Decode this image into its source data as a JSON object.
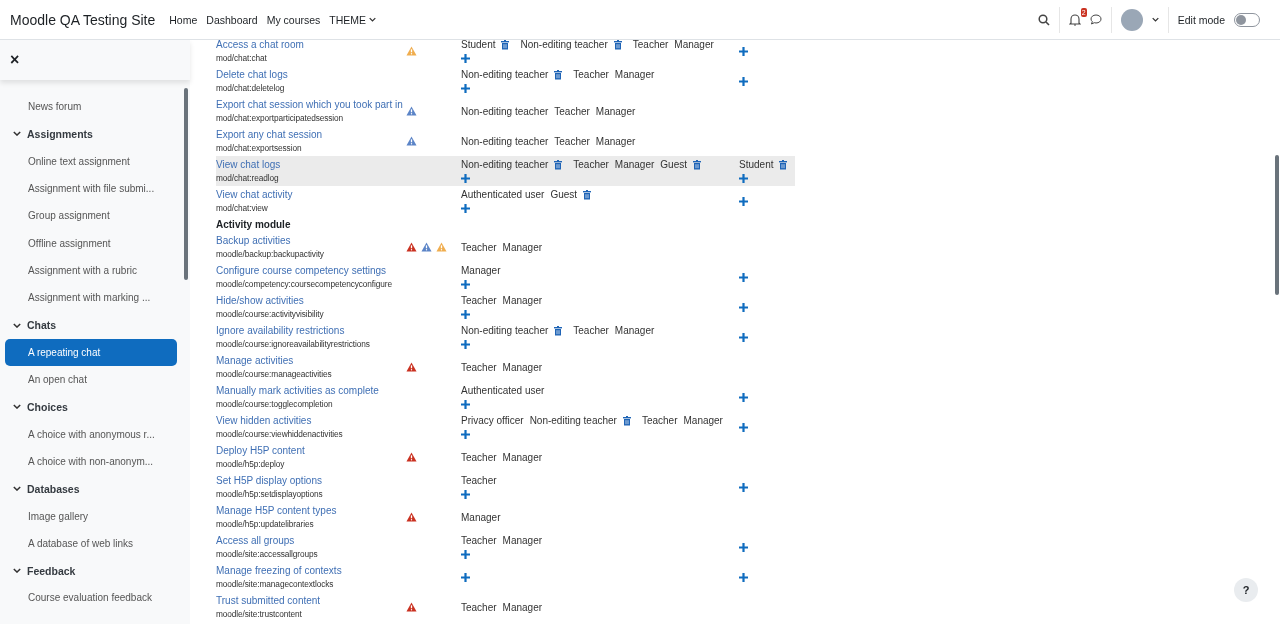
{
  "header": {
    "site_name": "Moodle QA Testing Site",
    "nav": [
      {
        "label": "Home",
        "dropdown": false
      },
      {
        "label": "Dashboard",
        "dropdown": false
      },
      {
        "label": "My courses",
        "dropdown": false
      },
      {
        "label": "THEME",
        "dropdown": true
      }
    ],
    "notification_count": "2",
    "edit_mode": {
      "label": "Edit mode",
      "on": false
    }
  },
  "drawer": {
    "close": "×",
    "sections": [
      {
        "items": [
          {
            "label": "News forum",
            "selected": false
          }
        ]
      },
      {
        "title": "Assignments",
        "expanded": true,
        "items": [
          {
            "label": "Online text assignment",
            "selected": false
          },
          {
            "label": "Assignment with file submi...",
            "selected": false
          },
          {
            "label": "Group assignment",
            "selected": false
          },
          {
            "label": "Offline assignment",
            "selected": false
          },
          {
            "label": "Assignment with a rubric",
            "selected": false
          },
          {
            "label": "Assignment with marking ...",
            "selected": false
          }
        ]
      },
      {
        "title": "Chats",
        "expanded": true,
        "items": [
          {
            "label": "A repeating chat",
            "selected": true
          },
          {
            "label": "An open chat",
            "selected": false
          }
        ]
      },
      {
        "title": "Choices",
        "expanded": true,
        "items": [
          {
            "label": "A choice with anonymous r...",
            "selected": false
          },
          {
            "label": "A choice with non-anonym...",
            "selected": false
          }
        ]
      },
      {
        "title": "Databases",
        "expanded": true,
        "items": [
          {
            "label": "Image gallery",
            "selected": false
          },
          {
            "label": "A database of web links",
            "selected": false
          }
        ]
      },
      {
        "title": "Feedback",
        "expanded": true,
        "items": [
          {
            "label": "Course evaluation feedback",
            "selected": false
          }
        ]
      }
    ]
  },
  "capabilities": [
    {
      "kind": "row",
      "name": "Access a chat room",
      "capability": "mod/chat:chat",
      "risks": [
        {
          "color": "#f0ad4e"
        }
      ],
      "highlighted": false,
      "allowed": {
        "roles": [
          {
            "name": "Student",
            "removable": true
          },
          {
            "name": "Non-editing teacher",
            "removable": true
          },
          {
            "name": "Teacher",
            "removable": false
          },
          {
            "name": "Manager",
            "removable": false
          }
        ],
        "addable": true
      },
      "prohibited": {
        "addable": true
      }
    },
    {
      "kind": "row",
      "name": "Delete chat logs",
      "capability": "mod/chat:deletelog",
      "highlighted": false,
      "allowed": {
        "roles": [
          {
            "name": "Non-editing teacher",
            "removable": true
          },
          {
            "name": "Teacher",
            "removable": false
          },
          {
            "name": "Manager",
            "removable": false
          }
        ],
        "addable": true
      },
      "prohibited": {
        "addable": true
      }
    },
    {
      "kind": "row",
      "name": "Export chat session which you took part in",
      "capability": "mod/chat:exportparticipatedsession",
      "risks": [
        {
          "color": "#5b84c7"
        }
      ],
      "highlighted": false,
      "allowed": {
        "roles": [
          {
            "name": "Non-editing teacher",
            "removable": false
          },
          {
            "name": "Teacher",
            "removable": false
          },
          {
            "name": "Manager",
            "removable": false
          }
        ],
        "addable": false
      }
    },
    {
      "kind": "row",
      "name": "Export any chat session",
      "capability": "mod/chat:exportsession",
      "risks": [
        {
          "color": "#5b84c7"
        }
      ],
      "highlighted": false,
      "allowed": {
        "roles": [
          {
            "name": "Non-editing teacher",
            "removable": false
          },
          {
            "name": "Teacher",
            "removable": false
          },
          {
            "name": "Manager",
            "removable": false
          }
        ],
        "addable": false
      }
    },
    {
      "kind": "row",
      "name": "View chat logs",
      "capability": "mod/chat:readlog",
      "highlighted": true,
      "allowed": {
        "roles": [
          {
            "name": "Non-editing teacher",
            "removable": true
          },
          {
            "name": "Teacher",
            "removable": false
          },
          {
            "name": "Manager",
            "removable": false
          },
          {
            "name": "Guest",
            "removable": true
          }
        ],
        "addable": true
      },
      "prohibited": {
        "roles": [
          {
            "name": "Student",
            "removable": true
          }
        ],
        "addable": true
      }
    },
    {
      "kind": "row",
      "name": "View chat activity",
      "capability": "mod/chat:view",
      "highlighted": false,
      "allowed": {
        "roles": [
          {
            "name": "Authenticated user",
            "removable": false
          },
          {
            "name": "Guest",
            "removable": true
          }
        ],
        "addable": true
      },
      "prohibited": {
        "addable": true
      }
    },
    {
      "kind": "group",
      "name": "Activity module"
    },
    {
      "kind": "row",
      "name": "Backup activities",
      "capability": "moodle/backup:backupactivity",
      "risks": [
        {
          "color": "#ca3120"
        },
        {
          "color": "#5b84c7"
        },
        {
          "color": "#f0ad4e"
        }
      ],
      "highlighted": false,
      "allowed": {
        "roles": [
          {
            "name": "Teacher",
            "removable": false
          },
          {
            "name": "Manager",
            "removable": false
          }
        ],
        "addable": false
      }
    },
    {
      "kind": "row",
      "name": "Configure course competency settings",
      "capability": "moodle/competency:coursecompetencyconfigure",
      "highlighted": false,
      "allowed": {
        "roles": [
          {
            "name": "Manager",
            "removable": false
          }
        ],
        "addable": true
      },
      "prohibited": {
        "addable": true
      }
    },
    {
      "kind": "row",
      "name": "Hide/show activities",
      "capability": "moodle/course:activityvisibility",
      "highlighted": false,
      "allowed": {
        "roles": [
          {
            "name": "Teacher",
            "removable": false
          },
          {
            "name": "Manager",
            "removable": false
          }
        ],
        "addable": true
      },
      "prohibited": {
        "addable": true
      }
    },
    {
      "kind": "row",
      "name": "Ignore availability restrictions",
      "capability": "moodle/course:ignoreavailabilityrestrictions",
      "highlighted": false,
      "allowed": {
        "roles": [
          {
            "name": "Non-editing teacher",
            "removable": true
          },
          {
            "name": "Teacher",
            "removable": false
          },
          {
            "name": "Manager",
            "removable": false
          }
        ],
        "addable": true
      },
      "prohibited": {
        "addable": true
      }
    },
    {
      "kind": "row",
      "name": "Manage activities",
      "capability": "moodle/course:manageactivities",
      "risks": [
        {
          "color": "#ca3120"
        }
      ],
      "highlighted": false,
      "allowed": {
        "roles": [
          {
            "name": "Teacher",
            "removable": false
          },
          {
            "name": "Manager",
            "removable": false
          }
        ],
        "addable": false
      }
    },
    {
      "kind": "row",
      "name": "Manually mark activities as complete",
      "capability": "moodle/course:togglecompletion",
      "highlighted": false,
      "allowed": {
        "roles": [
          {
            "name": "Authenticated user",
            "removable": false
          }
        ],
        "addable": true
      },
      "prohibited": {
        "addable": true
      }
    },
    {
      "kind": "row",
      "name": "View hidden activities",
      "capability": "moodle/course:viewhiddenactivities",
      "highlighted": false,
      "allowed": {
        "roles": [
          {
            "name": "Privacy officer",
            "removable": false
          },
          {
            "name": "Non-editing teacher",
            "removable": true
          },
          {
            "name": "Teacher",
            "removable": false
          },
          {
            "name": "Manager",
            "removable": false
          }
        ],
        "addable": true
      },
      "prohibited": {
        "addable": true
      }
    },
    {
      "kind": "row",
      "name": "Deploy H5P content",
      "capability": "moodle/h5p:deploy",
      "risks": [
        {
          "color": "#ca3120"
        }
      ],
      "highlighted": false,
      "allowed": {
        "roles": [
          {
            "name": "Teacher",
            "removable": false
          },
          {
            "name": "Manager",
            "removable": false
          }
        ],
        "addable": false
      }
    },
    {
      "kind": "row",
      "name": "Set H5P display options",
      "capability": "moodle/h5p:setdisplayoptions",
      "highlighted": false,
      "allowed": {
        "roles": [
          {
            "name": "Teacher",
            "removable": false
          }
        ],
        "addable": true
      },
      "prohibited": {
        "addable": true
      }
    },
    {
      "kind": "row",
      "name": "Manage H5P content types",
      "capability": "moodle/h5p:updatelibraries",
      "risks": [
        {
          "color": "#ca3120"
        }
      ],
      "highlighted": false,
      "allowed": {
        "roles": [
          {
            "name": "Manager",
            "removable": false
          }
        ],
        "addable": false
      }
    },
    {
      "kind": "row",
      "name": "Access all groups",
      "capability": "moodle/site:accessallgroups",
      "highlighted": false,
      "allowed": {
        "roles": [
          {
            "name": "Teacher",
            "removable": false
          },
          {
            "name": "Manager",
            "removable": false
          }
        ],
        "addable": true
      },
      "prohibited": {
        "addable": true
      }
    },
    {
      "kind": "row",
      "name": "Manage freezing of contexts",
      "capability": "moodle/site:managecontextlocks",
      "highlighted": false,
      "allowed": {
        "addable": true
      },
      "prohibited": {
        "addable": true
      }
    },
    {
      "kind": "row",
      "name": "Trust submitted content",
      "capability": "moodle/site:trustcontent",
      "risks": [
        {
          "color": "#ca3120"
        }
      ],
      "highlighted": false,
      "allowed": {
        "roles": [
          {
            "name": "Teacher",
            "removable": false
          },
          {
            "name": "Manager",
            "removable": false
          }
        ],
        "addable": false
      }
    }
  ],
  "help_button": "?"
}
